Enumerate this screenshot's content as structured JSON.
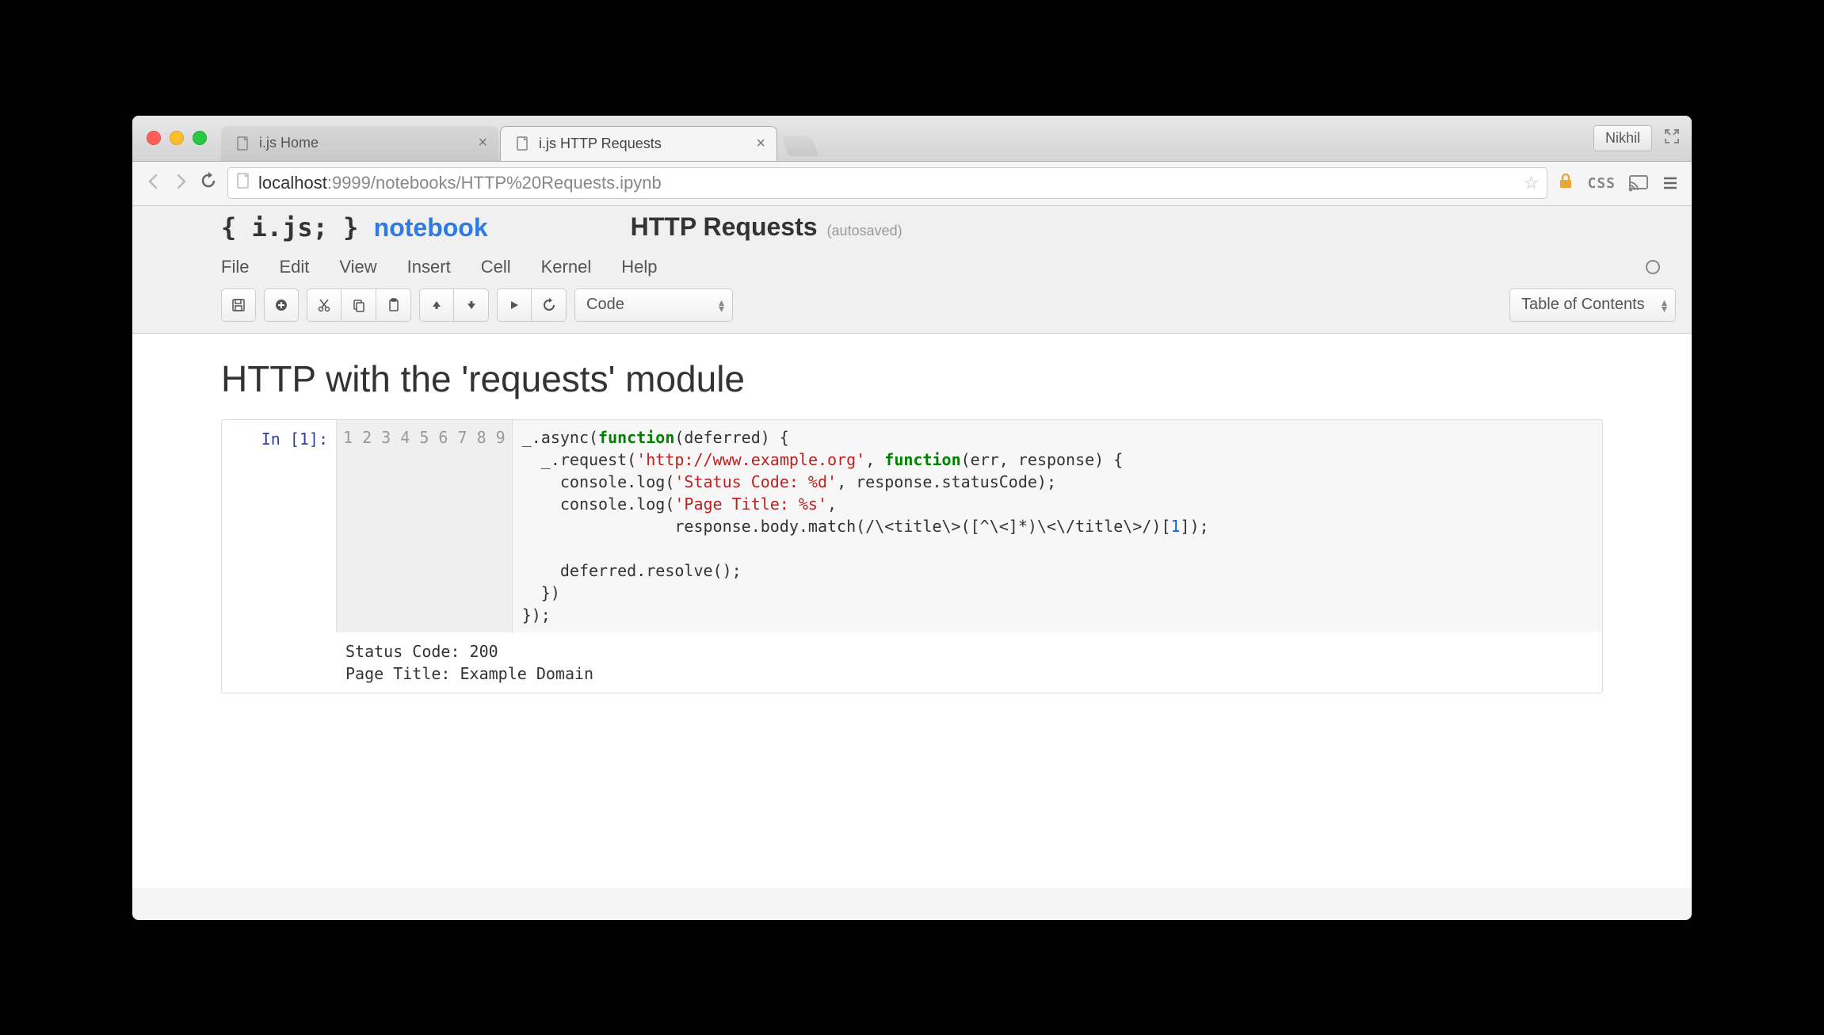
{
  "browser": {
    "tabs": [
      {
        "title": "i.js Home"
      },
      {
        "title": "i.js HTTP Requests"
      }
    ],
    "user_button": "Nikhil",
    "url_host": "localhost",
    "url_port": ":9999",
    "url_path": "/notebooks/HTTP%20Requests.ipynb",
    "css_label": "CSS"
  },
  "notebook": {
    "brand_prefix": "{ i.js; }",
    "brand_suffix": "notebook",
    "title": "HTTP Requests",
    "autosaved": "(autosaved)",
    "menus": [
      "File",
      "Edit",
      "View",
      "Insert",
      "Cell",
      "Kernel",
      "Help"
    ],
    "cell_type_selector": "Code",
    "toc_label": "Table of Contents"
  },
  "content": {
    "heading": "HTTP with the 'requests' module",
    "prompt": "In [1]:",
    "line_numbers": [
      "1",
      "2",
      "3",
      "4",
      "5",
      "6",
      "7",
      "8",
      "9"
    ],
    "code_tokens": [
      [
        {
          "t": "_.async("
        },
        {
          "t": "function",
          "c": "kw"
        },
        {
          "t": "(deferred) {"
        }
      ],
      [
        {
          "t": "  _.request("
        },
        {
          "t": "'http://www.example.org'",
          "c": "str"
        },
        {
          "t": ", "
        },
        {
          "t": "function",
          "c": "kw"
        },
        {
          "t": "(err, response) {"
        }
      ],
      [
        {
          "t": "    console.log("
        },
        {
          "t": "'Status Code: %d'",
          "c": "str"
        },
        {
          "t": ", response.statusCode);"
        }
      ],
      [
        {
          "t": "    console.log("
        },
        {
          "t": "'Page Title: %s'",
          "c": "str"
        },
        {
          "t": ","
        }
      ],
      [
        {
          "t": "                response.body.match(/\\<title\\>([^\\<]*)\\<\\/title\\>/)["
        },
        {
          "t": "1",
          "c": "num"
        },
        {
          "t": "]);"
        }
      ],
      [
        {
          "t": ""
        }
      ],
      [
        {
          "t": "    deferred.resolve();"
        }
      ],
      [
        {
          "t": "  })"
        }
      ],
      [
        {
          "t": "});"
        }
      ]
    ],
    "output_lines": [
      "Status Code: 200",
      "Page Title: Example Domain"
    ]
  }
}
